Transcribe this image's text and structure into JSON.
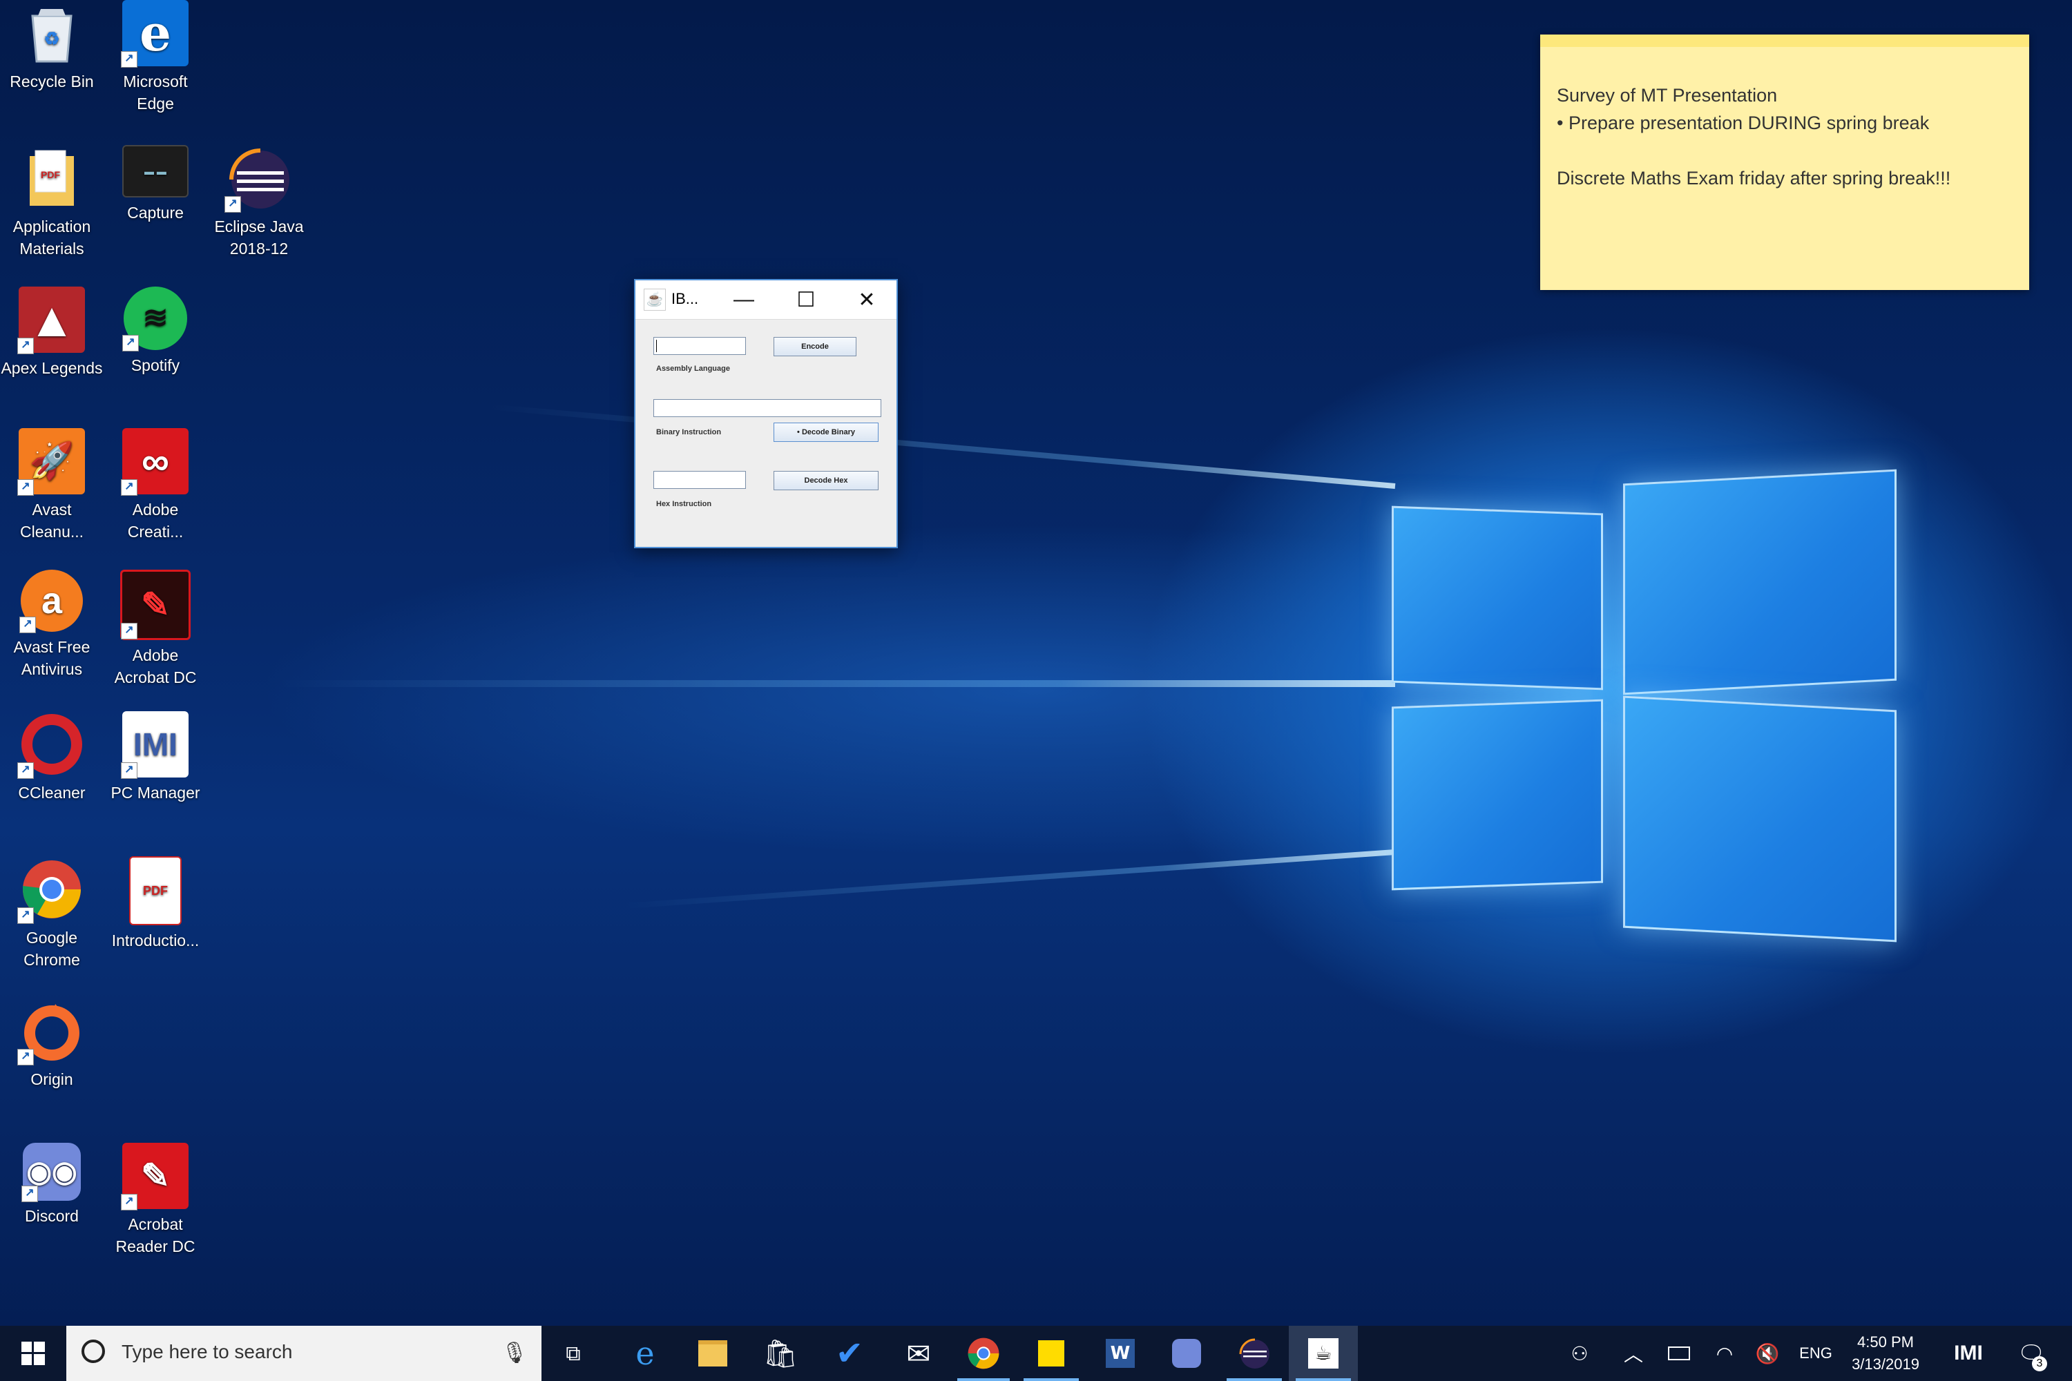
{
  "desktop": {
    "icons": [
      {
        "label": "Recycle Bin",
        "icon": "recycle-bin-icon"
      },
      {
        "label": "Microsoft Edge",
        "icon": "edge-icon"
      },
      {
        "label": "Application Materials",
        "icon": "folder-icon"
      },
      {
        "label": "Capture",
        "icon": "capture-icon"
      },
      {
        "label": "Eclipse Java 2018-12",
        "icon": "eclipse-icon"
      },
      {
        "label": "Apex Legends",
        "icon": "apex-icon"
      },
      {
        "label": "Spotify",
        "icon": "spotify-icon"
      },
      {
        "label": "Avast Cleanu...",
        "icon": "avast-cleanup-icon"
      },
      {
        "label": "Adobe Creati...",
        "icon": "adobe-cc-icon"
      },
      {
        "label": "Avast Free Antivirus",
        "icon": "avast-icon"
      },
      {
        "label": "Adobe Acrobat DC",
        "icon": "acrobat-icon"
      },
      {
        "label": "CCleaner",
        "icon": "ccleaner-icon"
      },
      {
        "label": "PC Manager",
        "icon": "pc-manager-icon"
      },
      {
        "label": "Google Chrome",
        "icon": "chrome-icon"
      },
      {
        "label": "Introductio...",
        "icon": "pdf-icon"
      },
      {
        "label": "Origin",
        "icon": "origin-icon"
      },
      {
        "label": "Discord",
        "icon": "discord-icon"
      },
      {
        "label": "Acrobat Reader DC",
        "icon": "acrobat-reader-icon"
      }
    ]
  },
  "sticky_note": {
    "line1": "Survey of MT Presentation",
    "line2": "• Prepare presentation DURING spring break",
    "line3": "Discrete Maths Exam friday after spring break!!!"
  },
  "java_window": {
    "title": "IB...",
    "minimize": "—",
    "maximize": "☐",
    "close": "✕",
    "assembly_label": "Assembly Language",
    "encode_button": "Encode",
    "binary_label": "Binary Instruction",
    "decode_binary_button": "• Decode Binary",
    "hex_label": "Hex Instruction",
    "decode_hex_button": "Decode Hex"
  },
  "taskbar": {
    "search_placeholder": "Type here to search",
    "language": "ENG",
    "time": "4:50 PM",
    "date": "3/13/2019",
    "notification_count": "3"
  },
  "colors": {
    "accent": "#4d8fd6",
    "sticky": "#fff1a8",
    "taskbar": "#0b1730"
  }
}
